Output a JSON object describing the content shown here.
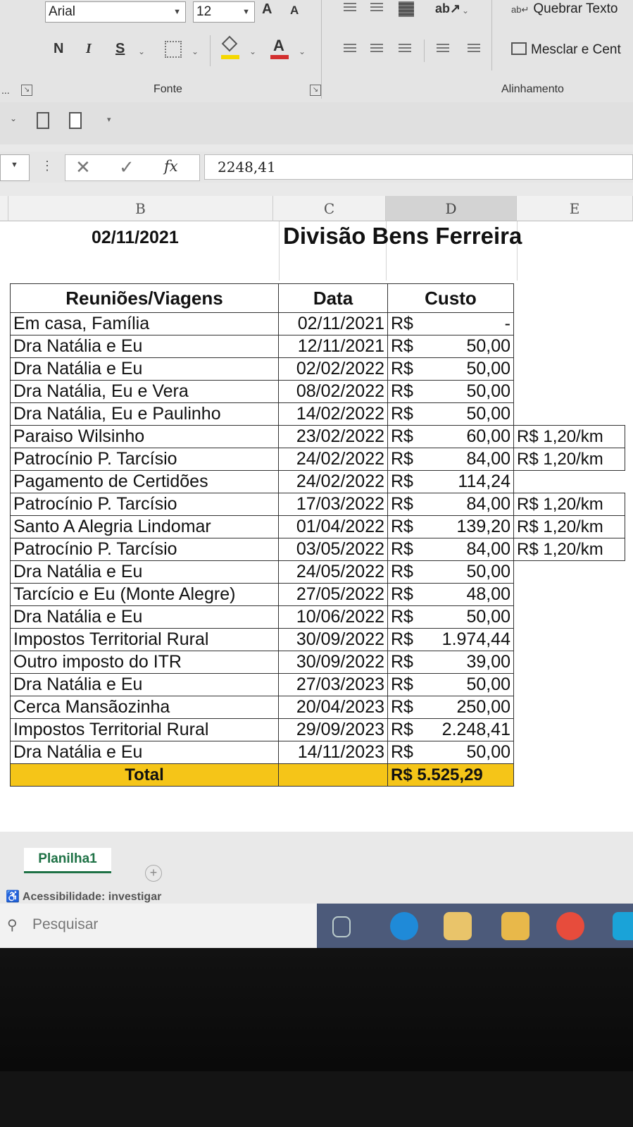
{
  "ribbon": {
    "font_name": "Arial",
    "font_size": "12",
    "bold": "N",
    "italic": "I",
    "underline": "S",
    "grow_font": "A",
    "shrink_font": "A",
    "wrap_text": "Quebrar Texto",
    "merge_center": "Mesclar e Cent",
    "group_more": "...",
    "group_font": "Fonte",
    "group_alignment": "Alinhamento",
    "font_color": "#d32f2f",
    "fill_color": "#f5d800"
  },
  "formula_bar": {
    "value": "2248,41"
  },
  "columns": [
    "B",
    "C",
    "D",
    "E"
  ],
  "selected_column": "D",
  "sheet": {
    "date": "02/11/2021",
    "title": "Divisão Bens Ferreira",
    "headers": {
      "desc": "Reuniões/Viagens",
      "date": "Data",
      "cost": "Custo"
    },
    "rows": [
      {
        "desc": "Em casa, Família",
        "date": "02/11/2021",
        "cur": "R$",
        "amount": "-",
        "rate": ""
      },
      {
        "desc": "Dra Natália e Eu",
        "date": "12/11/2021",
        "cur": "R$",
        "amount": "50,00",
        "rate": ""
      },
      {
        "desc": "Dra Natália e Eu",
        "date": "02/02/2022",
        "cur": "R$",
        "amount": "50,00",
        "rate": ""
      },
      {
        "desc": "Dra Natália, Eu e Vera",
        "date": "08/02/2022",
        "cur": "R$",
        "amount": "50,00",
        "rate": ""
      },
      {
        "desc": "Dra Natália, Eu e Paulinho",
        "date": "14/02/2022",
        "cur": "R$",
        "amount": "50,00",
        "rate": ""
      },
      {
        "desc": "Paraiso Wilsinho",
        "date": "23/02/2022",
        "cur": "R$",
        "amount": "60,00",
        "rate": "R$ 1,20/km"
      },
      {
        "desc": "Patrocínio P. Tarcísio",
        "date": "24/02/2022",
        "cur": "R$",
        "amount": "84,00",
        "rate": "R$ 1,20/km"
      },
      {
        "desc": "Pagamento de Certidões",
        "date": "24/02/2022",
        "cur": "R$",
        "amount": "114,24",
        "rate": ""
      },
      {
        "desc": "Patrocínio P. Tarcísio",
        "date": "17/03/2022",
        "cur": "R$",
        "amount": "84,00",
        "rate": "R$ 1,20/km"
      },
      {
        "desc": "Santo A Alegria Lindomar",
        "date": "01/04/2022",
        "cur": "R$",
        "amount": "139,20",
        "rate": "R$ 1,20/km"
      },
      {
        "desc": "Patrocínio P. Tarcísio",
        "date": "03/05/2022",
        "cur": "R$",
        "amount": "84,00",
        "rate": "R$ 1,20/km"
      },
      {
        "desc": "Dra Natália e Eu",
        "date": "24/05/2022",
        "cur": "R$",
        "amount": "50,00",
        "rate": ""
      },
      {
        "desc": "Tarcício e Eu (Monte Alegre)",
        "date": "27/05/2022",
        "cur": "R$",
        "amount": "48,00",
        "rate": ""
      },
      {
        "desc": "Dra Natália e Eu",
        "date": "10/06/2022",
        "cur": "R$",
        "amount": "50,00",
        "rate": ""
      },
      {
        "desc": "Impostos Territorial Rural",
        "date": "30/09/2022",
        "cur": "R$",
        "amount": "1.974,44",
        "rate": ""
      },
      {
        "desc": "Outro imposto do ITR",
        "date": "30/09/2022",
        "cur": "R$",
        "amount": "39,00",
        "rate": ""
      },
      {
        "desc": "Dra Natália e Eu",
        "date": "27/03/2023",
        "cur": "R$",
        "amount": "50,00",
        "rate": ""
      },
      {
        "desc": "Cerca Mansãozinha",
        "date": "20/04/2023",
        "cur": "R$",
        "amount": "250,00",
        "rate": ""
      },
      {
        "desc": "Impostos Territorial Rural",
        "date": "29/09/2023",
        "cur": "R$",
        "amount": "2.248,41",
        "rate": ""
      },
      {
        "desc": "Dra Natália e Eu",
        "date": "14/11/2023",
        "cur": "R$",
        "amount": "50,00",
        "rate": ""
      }
    ],
    "total_label": "Total",
    "total_value": "R$ 5.525,29",
    "total_color": "#f5c518"
  },
  "sheet_tab": "Planilha1",
  "add_sheet": "+",
  "status": "Acessibilidade: investigar",
  "taskbar": {
    "search_placeholder": "Pesquisar",
    "accent": "#4c5a7a"
  }
}
